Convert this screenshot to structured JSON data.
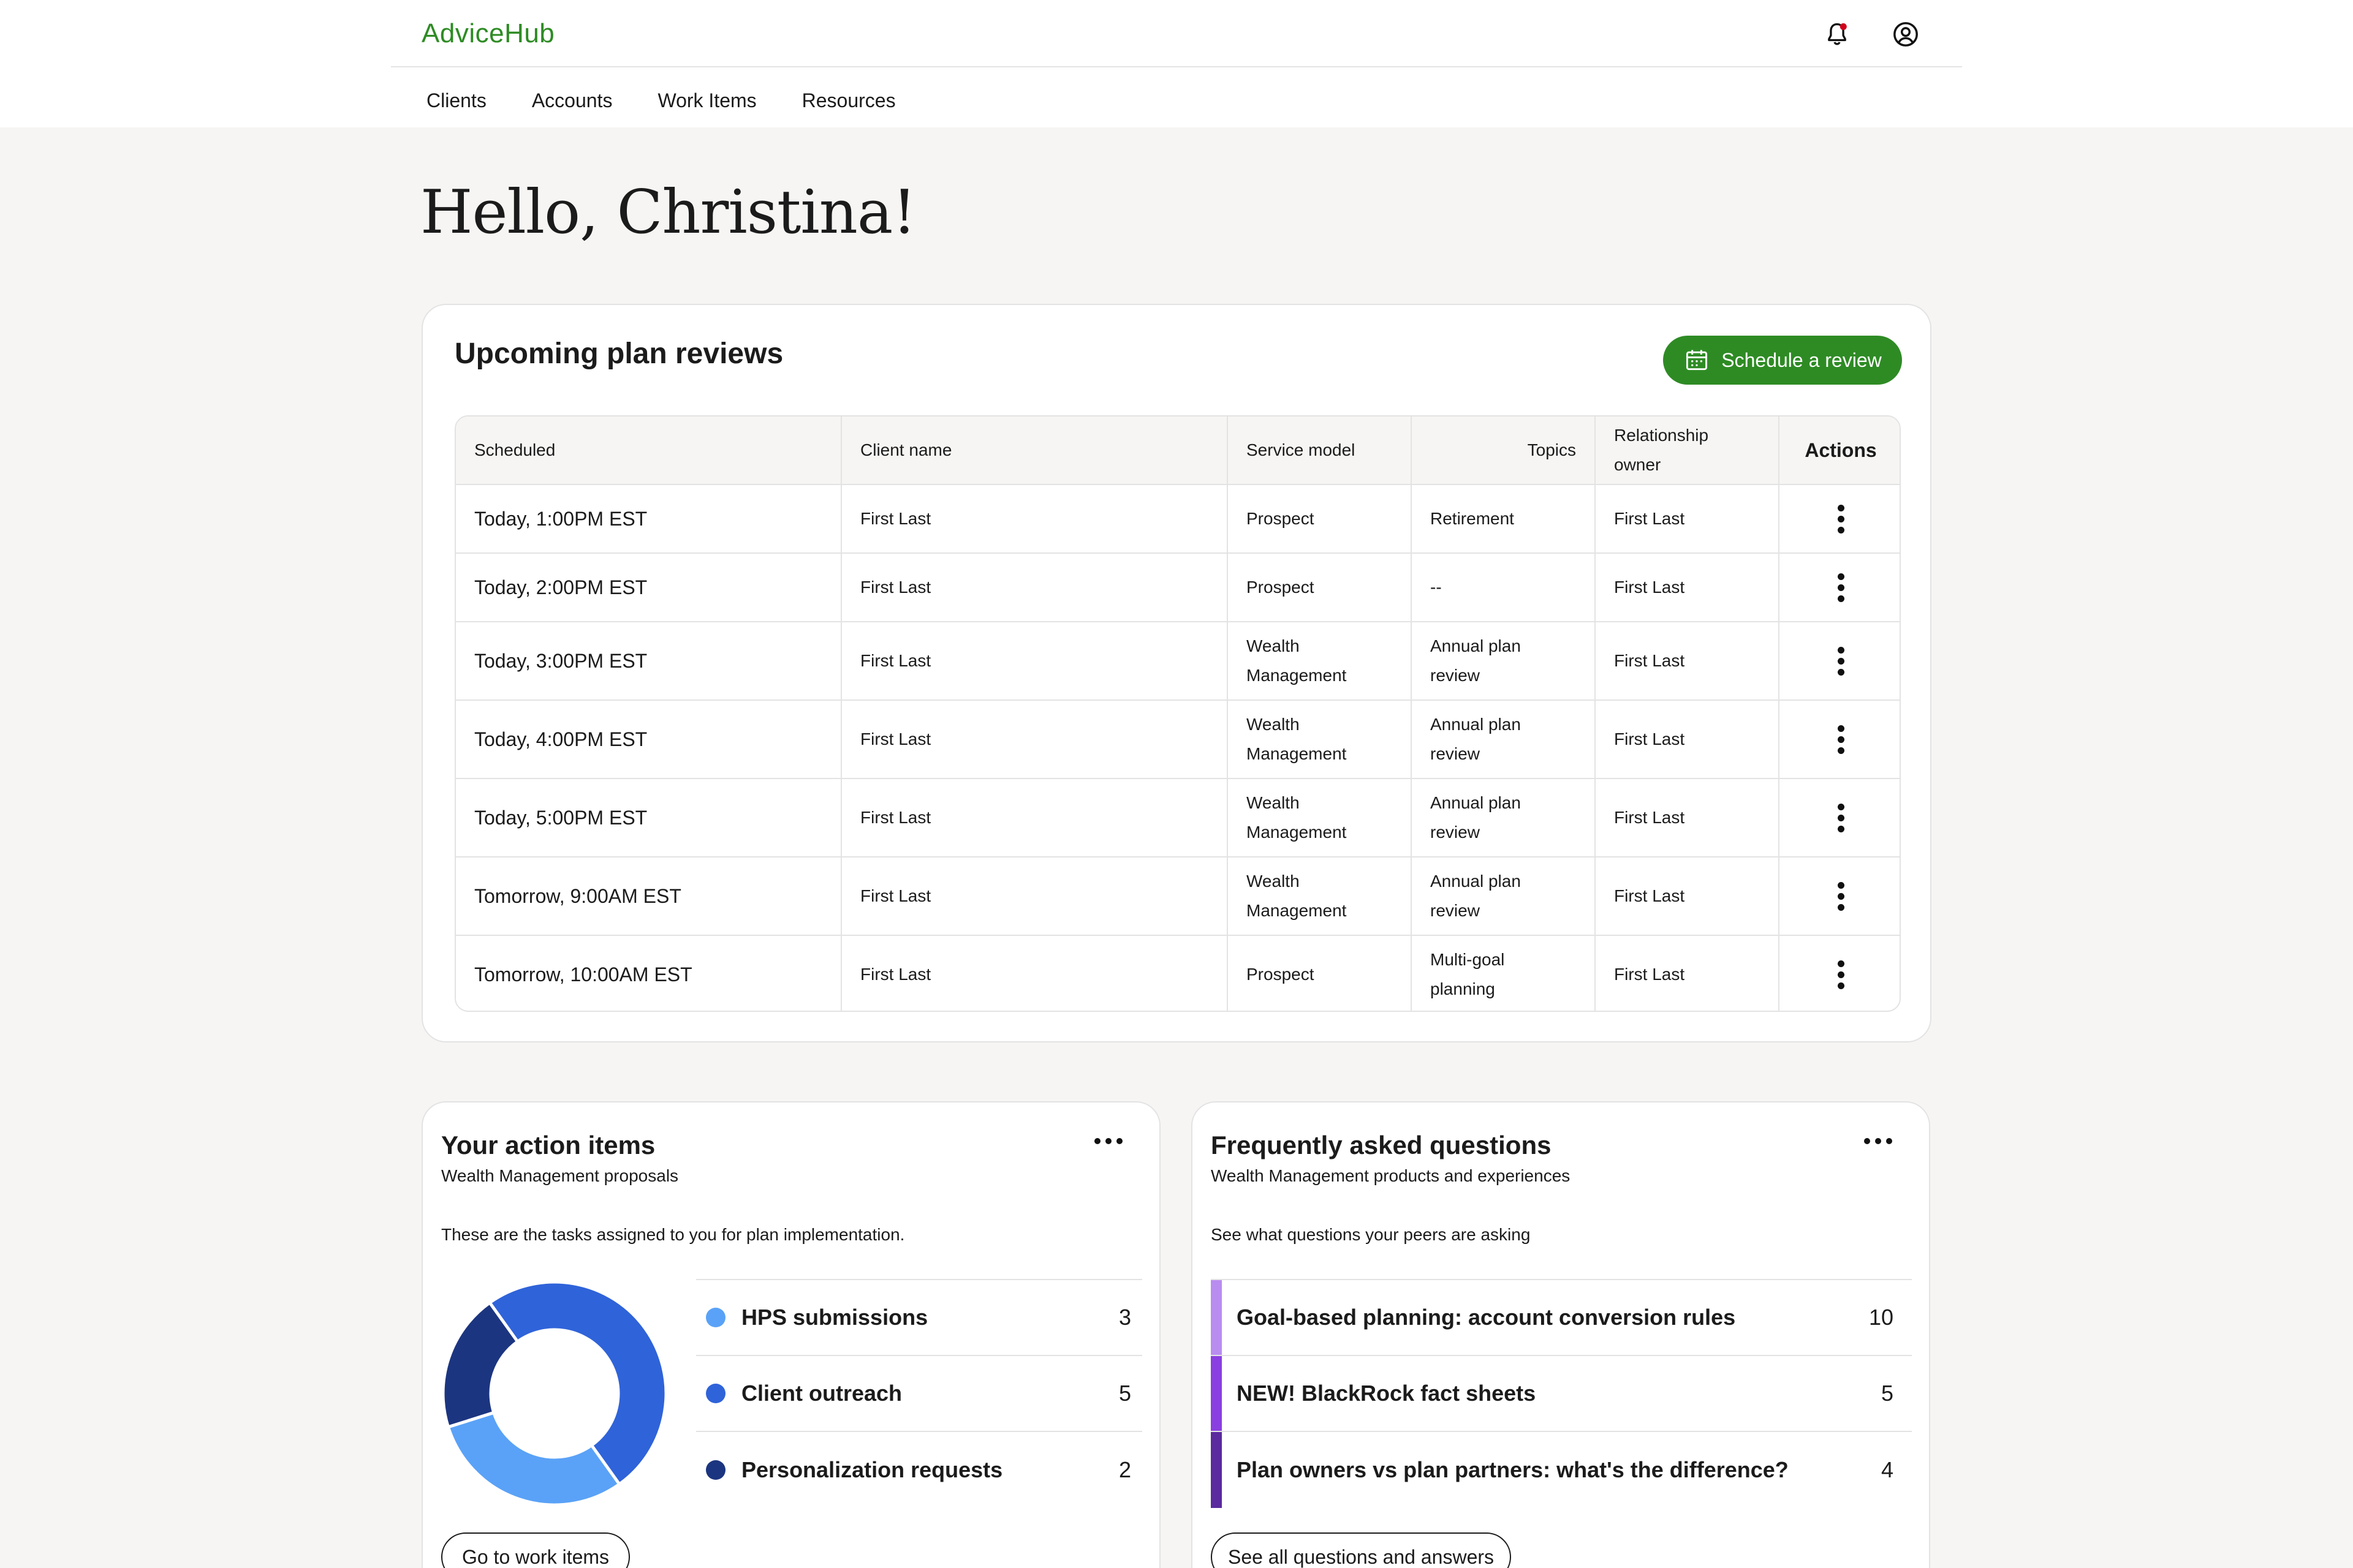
{
  "app": {
    "name": "AdviceHub"
  },
  "header": {
    "notification_icon": "bell-icon",
    "profile_icon": "user-circle-icon",
    "notification_dot_color": "#d0021b"
  },
  "nav": [
    {
      "label": "Clients"
    },
    {
      "label": "Accounts"
    },
    {
      "label": "Work Items"
    },
    {
      "label": "Resources"
    }
  ],
  "greeting": "Hello, Christina!",
  "reviews": {
    "title": "Upcoming plan reviews",
    "schedule_button": "Schedule a review",
    "columns": [
      "Scheduled",
      "Client name",
      "Service model",
      "Topics",
      "Relationship owner",
      "Actions"
    ],
    "rows": [
      {
        "scheduled": "Today, 1:00PM EST",
        "client": "First Last",
        "service_line1": "Prospect",
        "service_line2": "",
        "topic_line1": "Retirement",
        "topic_line2": "",
        "owner": "First Last"
      },
      {
        "scheduled": "Today, 2:00PM EST",
        "client": "First Last",
        "service_line1": "Prospect",
        "service_line2": "",
        "topic_line1": "--",
        "topic_line2": "",
        "owner": "First Last"
      },
      {
        "scheduled": "Today, 3:00PM EST",
        "client": "First Last",
        "service_line1": "Wealth",
        "service_line2": "Management",
        "topic_line1": "Annual plan",
        "topic_line2": "review",
        "owner": "First Last"
      },
      {
        "scheduled": "Today, 4:00PM EST",
        "client": "First Last",
        "service_line1": "Wealth",
        "service_line2": "Management",
        "topic_line1": "Annual plan",
        "topic_line2": "review",
        "owner": "First Last"
      },
      {
        "scheduled": "Today, 5:00PM EST",
        "client": "First Last",
        "service_line1": "Wealth",
        "service_line2": "Management",
        "topic_line1": "Annual plan",
        "topic_line2": "review",
        "owner": "First Last"
      },
      {
        "scheduled": "Tomorrow, 9:00AM EST",
        "client": "First Last",
        "service_line1": "Wealth",
        "service_line2": "Management",
        "topic_line1": "Annual plan",
        "topic_line2": "review",
        "owner": "First Last"
      },
      {
        "scheduled": "Tomorrow, 10:00AM EST",
        "client": "First Last",
        "service_line1": "Prospect",
        "service_line2": "",
        "topic_line1": "Multi-goal",
        "topic_line2": "planning",
        "owner": "First Last"
      }
    ]
  },
  "action_items": {
    "title": "Your action items",
    "subtitle": "Wealth Management proposals",
    "description": "These are the tasks assigned to you for plan implementation.",
    "items": [
      {
        "label": "HPS submissions",
        "count": "3",
        "value": 3,
        "color": "#5aa2f7"
      },
      {
        "label": "Client outreach",
        "count": "5",
        "value": 5,
        "color": "#2f63d9"
      },
      {
        "label": "Personalization requests",
        "count": "2",
        "value": 2,
        "color": "#1c3580"
      }
    ],
    "button": "Go to work items"
  },
  "faq": {
    "title": "Frequently asked questions",
    "subtitle": "Wealth Management products and experiences",
    "description": "See what questions your peers are asking",
    "items": [
      {
        "label": "Goal-based planning: account conversion rules",
        "count": "10",
        "color": "#b98cf0"
      },
      {
        "label": "NEW! BlackRock fact sheets",
        "count": "5",
        "color": "#8a3fe0"
      },
      {
        "label": "Plan owners vs plan partners: what's the difference?",
        "count": "4",
        "color": "#5a2a9e"
      }
    ],
    "button": "See all questions and answers"
  }
}
